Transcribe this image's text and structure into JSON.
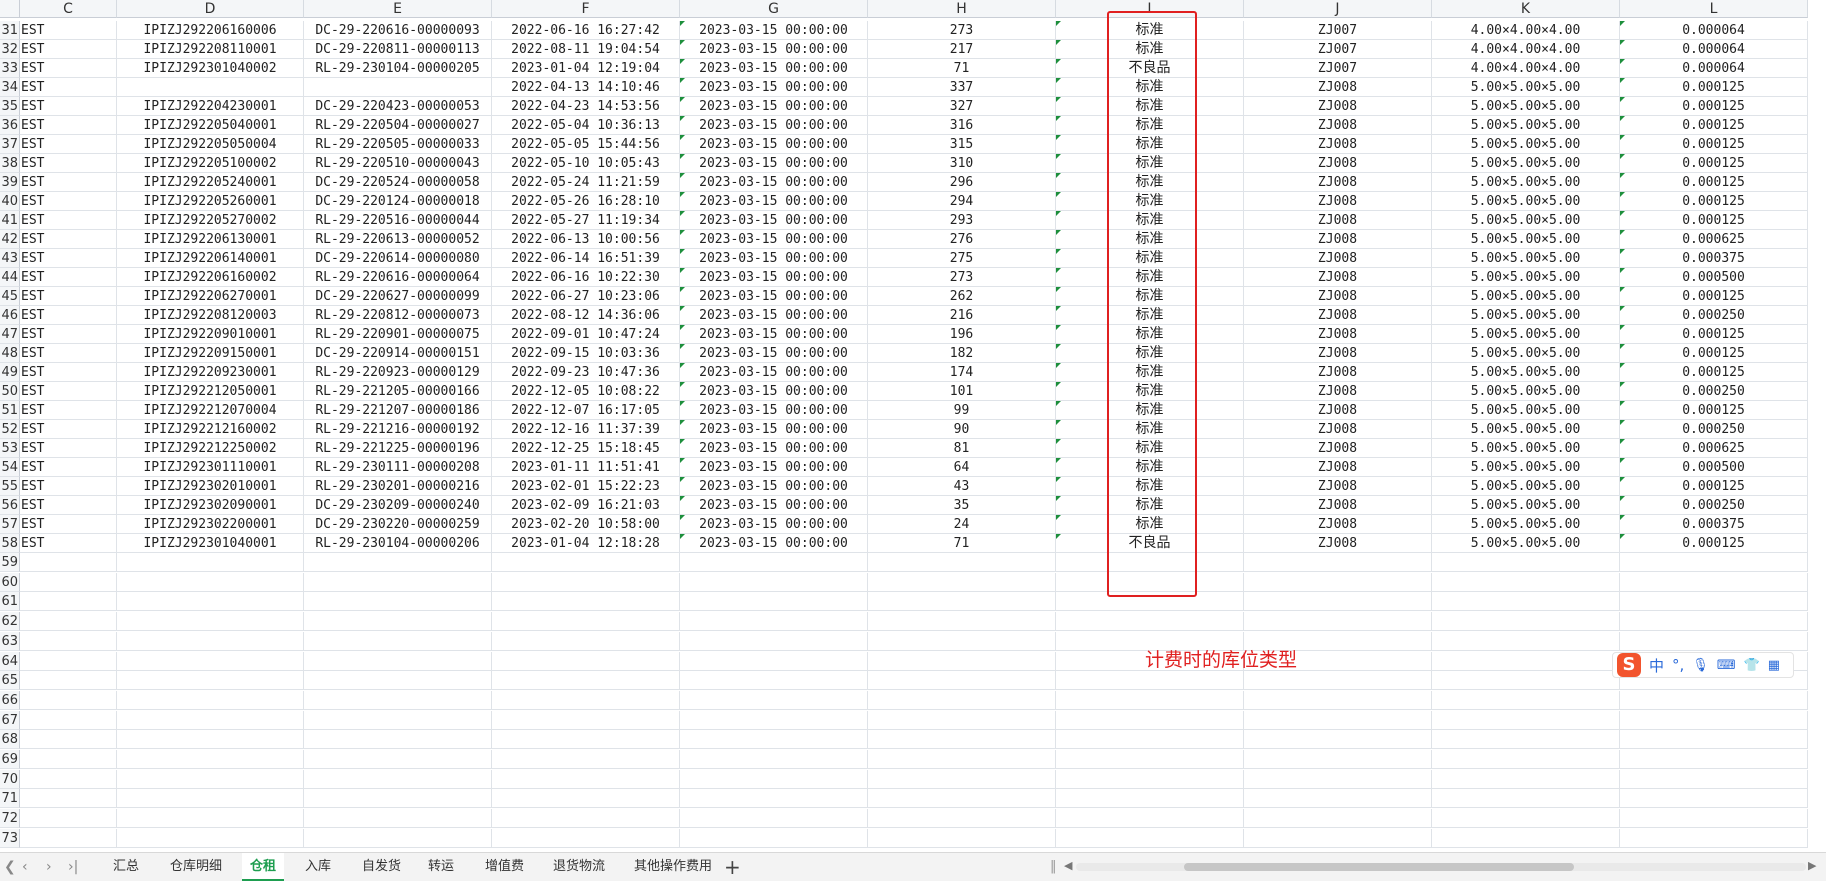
{
  "sheet": {
    "columns": [
      "C",
      "D",
      "E",
      "F",
      "G",
      "H",
      "I",
      "J",
      "K",
      "L"
    ],
    "rows": [
      {
        "n": "31",
        "c": "EST",
        "d": "IPIZJ292206160006",
        "e": "DC-29-220616-00000093",
        "f": "2022-06-16 16:27:42",
        "g": "2023-03-15 00:00:00",
        "h": "273",
        "i": "标准",
        "j": "ZJ007",
        "k": "4.00×4.00×4.00",
        "l": "0.000064"
      },
      {
        "n": "32",
        "c": "EST",
        "d": "IPIZJ292208110001",
        "e": "DC-29-220811-00000113",
        "f": "2022-08-11 19:04:54",
        "g": "2023-03-15 00:00:00",
        "h": "217",
        "i": "标准",
        "j": "ZJ007",
        "k": "4.00×4.00×4.00",
        "l": "0.000064"
      },
      {
        "n": "33",
        "c": "EST",
        "d": "IPIZJ292301040002",
        "e": "RL-29-230104-00000205",
        "f": "2023-01-04 12:19:04",
        "g": "2023-03-15 00:00:00",
        "h": "71",
        "i": "不良品",
        "j": "ZJ007",
        "k": "4.00×4.00×4.00",
        "l": "0.000064"
      },
      {
        "n": "34",
        "c": "EST",
        "d": "",
        "e": "",
        "f": "2022-04-13 14:10:46",
        "g": "2023-03-15 00:00:00",
        "h": "337",
        "i": "标准",
        "j": "ZJ008",
        "k": "5.00×5.00×5.00",
        "l": "0.000125"
      },
      {
        "n": "35",
        "c": "EST",
        "d": "IPIZJ292204230001",
        "e": "DC-29-220423-00000053",
        "f": "2022-04-23 14:53:56",
        "g": "2023-03-15 00:00:00",
        "h": "327",
        "i": "标准",
        "j": "ZJ008",
        "k": "5.00×5.00×5.00",
        "l": "0.000125"
      },
      {
        "n": "36",
        "c": "EST",
        "d": "IPIZJ292205040001",
        "e": "RL-29-220504-00000027",
        "f": "2022-05-04 10:36:13",
        "g": "2023-03-15 00:00:00",
        "h": "316",
        "i": "标准",
        "j": "ZJ008",
        "k": "5.00×5.00×5.00",
        "l": "0.000125"
      },
      {
        "n": "37",
        "c": "EST",
        "d": "IPIZJ292205050004",
        "e": "RL-29-220505-00000033",
        "f": "2022-05-05 15:44:56",
        "g": "2023-03-15 00:00:00",
        "h": "315",
        "i": "标准",
        "j": "ZJ008",
        "k": "5.00×5.00×5.00",
        "l": "0.000125"
      },
      {
        "n": "38",
        "c": "EST",
        "d": "IPIZJ292205100002",
        "e": "RL-29-220510-00000043",
        "f": "2022-05-10 10:05:43",
        "g": "2023-03-15 00:00:00",
        "h": "310",
        "i": "标准",
        "j": "ZJ008",
        "k": "5.00×5.00×5.00",
        "l": "0.000125"
      },
      {
        "n": "39",
        "c": "EST",
        "d": "IPIZJ292205240001",
        "e": "DC-29-220524-00000058",
        "f": "2022-05-24 11:21:59",
        "g": "2023-03-15 00:00:00",
        "h": "296",
        "i": "标准",
        "j": "ZJ008",
        "k": "5.00×5.00×5.00",
        "l": "0.000125"
      },
      {
        "n": "40",
        "c": "EST",
        "d": "IPIZJ292205260001",
        "e": "DC-29-220124-00000018",
        "f": "2022-05-26 16:28:10",
        "g": "2023-03-15 00:00:00",
        "h": "294",
        "i": "标准",
        "j": "ZJ008",
        "k": "5.00×5.00×5.00",
        "l": "0.000125"
      },
      {
        "n": "41",
        "c": "EST",
        "d": "IPIZJ292205270002",
        "e": "RL-29-220516-00000044",
        "f": "2022-05-27 11:19:34",
        "g": "2023-03-15 00:00:00",
        "h": "293",
        "i": "标准",
        "j": "ZJ008",
        "k": "5.00×5.00×5.00",
        "l": "0.000125"
      },
      {
        "n": "42",
        "c": "EST",
        "d": "IPIZJ292206130001",
        "e": "RL-29-220613-00000052",
        "f": "2022-06-13 10:00:56",
        "g": "2023-03-15 00:00:00",
        "h": "276",
        "i": "标准",
        "j": "ZJ008",
        "k": "5.00×5.00×5.00",
        "l": "0.000625"
      },
      {
        "n": "43",
        "c": "EST",
        "d": "IPIZJ292206140001",
        "e": "DC-29-220614-00000080",
        "f": "2022-06-14 16:51:39",
        "g": "2023-03-15 00:00:00",
        "h": "275",
        "i": "标准",
        "j": "ZJ008",
        "k": "5.00×5.00×5.00",
        "l": "0.000375"
      },
      {
        "n": "44",
        "c": "EST",
        "d": "IPIZJ292206160002",
        "e": "RL-29-220616-00000064",
        "f": "2022-06-16 10:22:30",
        "g": "2023-03-15 00:00:00",
        "h": "273",
        "i": "标准",
        "j": "ZJ008",
        "k": "5.00×5.00×5.00",
        "l": "0.000500"
      },
      {
        "n": "45",
        "c": "EST",
        "d": "IPIZJ292206270001",
        "e": "DC-29-220627-00000099",
        "f": "2022-06-27 10:23:06",
        "g": "2023-03-15 00:00:00",
        "h": "262",
        "i": "标准",
        "j": "ZJ008",
        "k": "5.00×5.00×5.00",
        "l": "0.000125"
      },
      {
        "n": "46",
        "c": "EST",
        "d": "IPIZJ292208120003",
        "e": "RL-29-220812-00000073",
        "f": "2022-08-12 14:36:06",
        "g": "2023-03-15 00:00:00",
        "h": "216",
        "i": "标准",
        "j": "ZJ008",
        "k": "5.00×5.00×5.00",
        "l": "0.000250"
      },
      {
        "n": "47",
        "c": "EST",
        "d": "IPIZJ292209010001",
        "e": "RL-29-220901-00000075",
        "f": "2022-09-01 10:47:24",
        "g": "2023-03-15 00:00:00",
        "h": "196",
        "i": "标准",
        "j": "ZJ008",
        "k": "5.00×5.00×5.00",
        "l": "0.000125"
      },
      {
        "n": "48",
        "c": "EST",
        "d": "IPIZJ292209150001",
        "e": "DC-29-220914-00000151",
        "f": "2022-09-15 10:03:36",
        "g": "2023-03-15 00:00:00",
        "h": "182",
        "i": "标准",
        "j": "ZJ008",
        "k": "5.00×5.00×5.00",
        "l": "0.000125"
      },
      {
        "n": "49",
        "c": "EST",
        "d": "IPIZJ292209230001",
        "e": "RL-29-220923-00000129",
        "f": "2022-09-23 10:47:36",
        "g": "2023-03-15 00:00:00",
        "h": "174",
        "i": "标准",
        "j": "ZJ008",
        "k": "5.00×5.00×5.00",
        "l": "0.000125"
      },
      {
        "n": "50",
        "c": "EST",
        "d": "IPIZJ292212050001",
        "e": "RL-29-221205-00000166",
        "f": "2022-12-05 10:08:22",
        "g": "2023-03-15 00:00:00",
        "h": "101",
        "i": "标准",
        "j": "ZJ008",
        "k": "5.00×5.00×5.00",
        "l": "0.000250"
      },
      {
        "n": "51",
        "c": "EST",
        "d": "IPIZJ292212070004",
        "e": "RL-29-221207-00000186",
        "f": "2022-12-07 16:17:05",
        "g": "2023-03-15 00:00:00",
        "h": "99",
        "i": "标准",
        "j": "ZJ008",
        "k": "5.00×5.00×5.00",
        "l": "0.000125"
      },
      {
        "n": "52",
        "c": "EST",
        "d": "IPIZJ292212160002",
        "e": "RL-29-221216-00000192",
        "f": "2022-12-16 11:37:39",
        "g": "2023-03-15 00:00:00",
        "h": "90",
        "i": "标准",
        "j": "ZJ008",
        "k": "5.00×5.00×5.00",
        "l": "0.000250"
      },
      {
        "n": "53",
        "c": "EST",
        "d": "IPIZJ292212250002",
        "e": "RL-29-221225-00000196",
        "f": "2022-12-25 15:18:45",
        "g": "2023-03-15 00:00:00",
        "h": "81",
        "i": "标准",
        "j": "ZJ008",
        "k": "5.00×5.00×5.00",
        "l": "0.000625"
      },
      {
        "n": "54",
        "c": "EST",
        "d": "IPIZJ292301110001",
        "e": "RL-29-230111-00000208",
        "f": "2023-01-11 11:51:41",
        "g": "2023-03-15 00:00:00",
        "h": "64",
        "i": "标准",
        "j": "ZJ008",
        "k": "5.00×5.00×5.00",
        "l": "0.000500"
      },
      {
        "n": "55",
        "c": "EST",
        "d": "IPIZJ292302010001",
        "e": "RL-29-230201-00000216",
        "f": "2023-02-01 15:22:23",
        "g": "2023-03-15 00:00:00",
        "h": "43",
        "i": "标准",
        "j": "ZJ008",
        "k": "5.00×5.00×5.00",
        "l": "0.000125"
      },
      {
        "n": "56",
        "c": "EST",
        "d": "IPIZJ292302090001",
        "e": "DC-29-230209-00000240",
        "f": "2023-02-09 16:21:03",
        "g": "2023-03-15 00:00:00",
        "h": "35",
        "i": "标准",
        "j": "ZJ008",
        "k": "5.00×5.00×5.00",
        "l": "0.000250"
      },
      {
        "n": "57",
        "c": "EST",
        "d": "IPIZJ292302200001",
        "e": "DC-29-230220-00000259",
        "f": "2023-02-20 10:58:00",
        "g": "2023-03-15 00:00:00",
        "h": "24",
        "i": "标准",
        "j": "ZJ008",
        "k": "5.00×5.00×5.00",
        "l": "0.000375"
      },
      {
        "n": "58",
        "c": "EST",
        "d": "IPIZJ292301040001",
        "e": "RL-29-230104-00000206",
        "f": "2023-01-04 12:18:28",
        "g": "2023-03-15 00:00:00",
        "h": "71",
        "i": "不良品",
        "j": "ZJ008",
        "k": "5.00×5.00×5.00",
        "l": "0.000125"
      }
    ],
    "empty_rows": [
      "59",
      "60",
      "61",
      "62",
      "63",
      "64",
      "65",
      "66",
      "67",
      "68",
      "69",
      "70",
      "71",
      "72",
      "73"
    ]
  },
  "annotation": {
    "text": "计费时的库位类型",
    "color": "#e02020"
  },
  "ime": {
    "logo": "S",
    "mode": "中",
    "punct": "°,"
  },
  "tabs": {
    "items": [
      "汇总",
      "仓库明细",
      "仓租",
      "入库",
      "自发货",
      "转运",
      "增值费",
      "退货物流",
      "其他操作费用"
    ],
    "active": "仓租",
    "add": "+"
  },
  "colors": {
    "accent": "#1e9e50",
    "highlight": "#e02020",
    "ime_brand": "#f2542d"
  }
}
